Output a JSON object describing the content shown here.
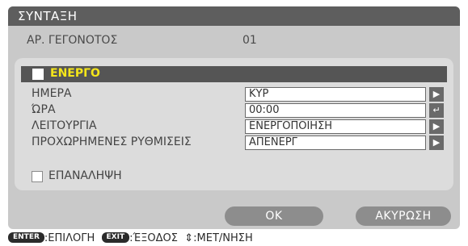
{
  "title": "ΣΥΝΤΑΞΗ",
  "event": {
    "label": "ΑΡ. ΓΕΓΟΝΟΤΟΣ",
    "value": "01"
  },
  "active": {
    "label": "ΕΝΕΡΓΟ",
    "checked": false
  },
  "rows": [
    {
      "label": "ΗΜΕΡΑ",
      "value": "ΚΥΡ",
      "button_icon": "right-arrow-icon",
      "button_glyph": "▶"
    },
    {
      "label": "ΏΡΑ",
      "value": "00:00",
      "button_icon": "enter-return-icon",
      "button_glyph": "↵"
    },
    {
      "label": "ΛΕΙΤΟΥΡΓΙΑ",
      "value": "ΕΝΕΡΓΟΠΟΙΗΣΗ",
      "button_icon": "right-arrow-icon",
      "button_glyph": "▶"
    },
    {
      "label": "ΠΡΟΧΩΡΗΜΕΝΕΣ ΡΥΘΜΙΣΕΙΣ",
      "value": "ΑΠΕΝΕΡΓ",
      "button_icon": "right-arrow-icon",
      "button_glyph": "▶"
    }
  ],
  "repeat": {
    "label": "ΕΠΑΝΑΛΗΨΗ",
    "checked": false
  },
  "buttons": {
    "ok": "OK",
    "cancel": "ΑΚΥΡΩΣΗ"
  },
  "footer": {
    "enter_key": "ENTER",
    "enter_hint": ":ΕΠΙΛΟΓΗ",
    "exit_key": "EXIT",
    "exit_hint": ":ΈΞΟΔΟΣ",
    "move_glyph": "⇕",
    "move_hint": ":ΜΕΤ/ΝΗΣΗ"
  },
  "colors": {
    "titlebar": "#5e5e5e",
    "active_label": "#f5e61a",
    "button": "#8d8d8d",
    "dialog": "#c9c9c9"
  }
}
